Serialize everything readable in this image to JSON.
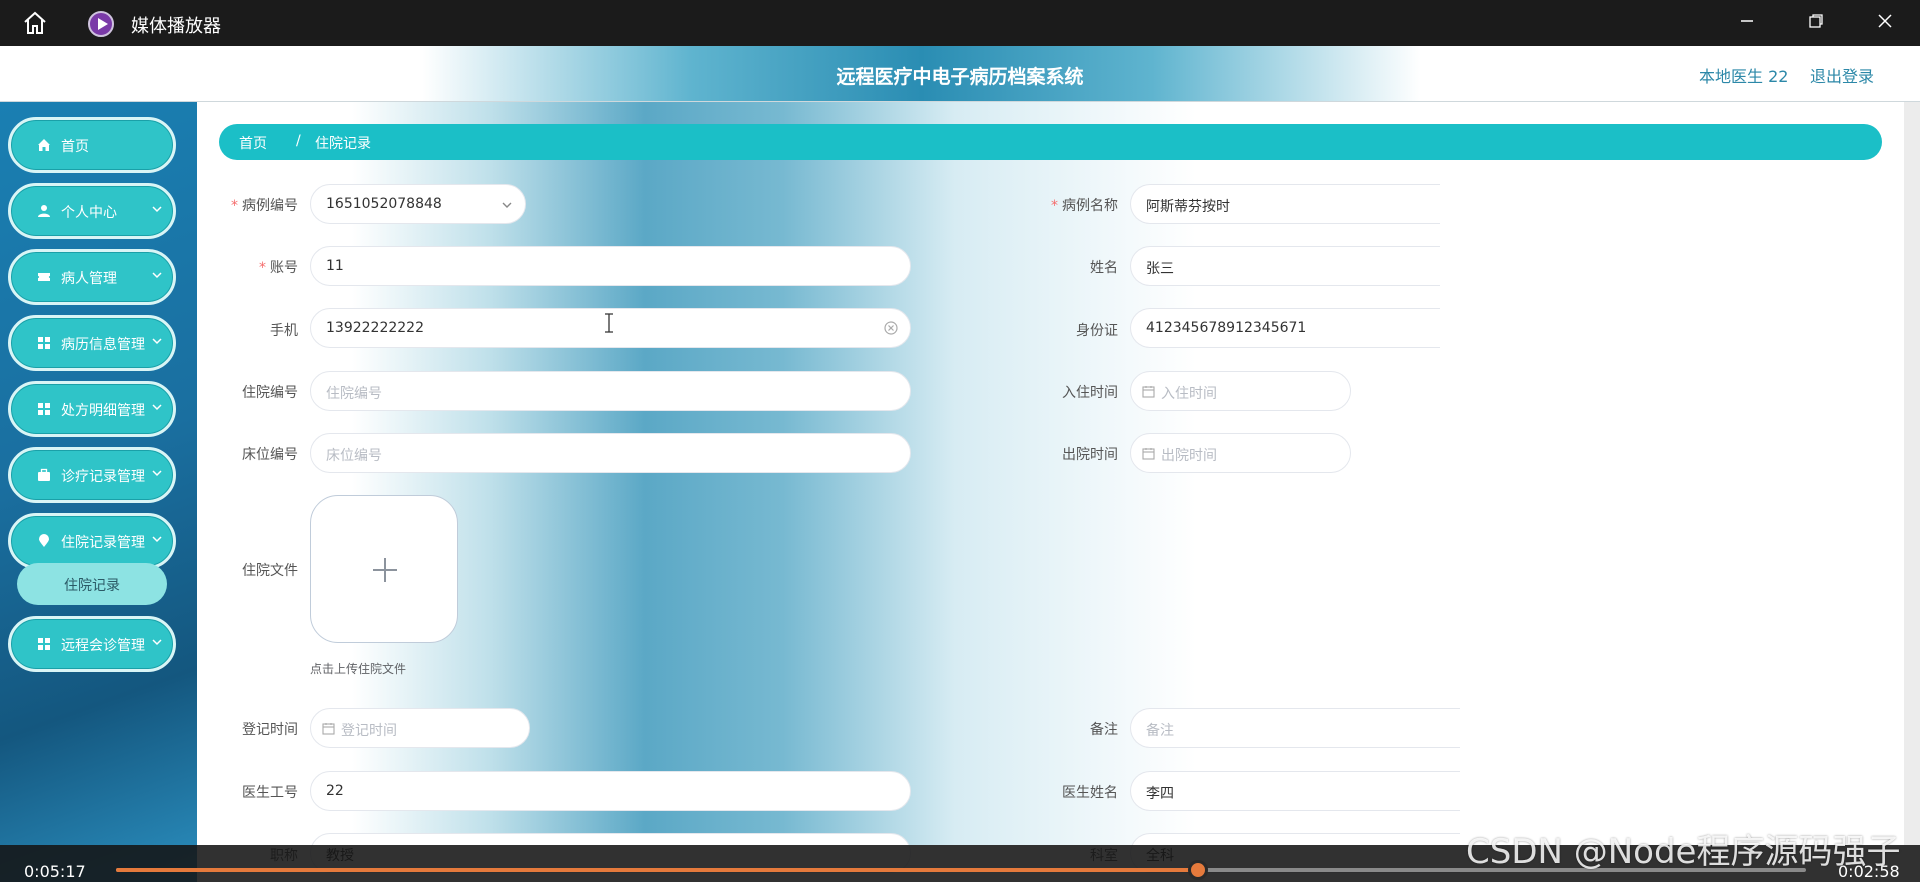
{
  "window": {
    "app_title": "媒体播放器"
  },
  "header": {
    "system_title": "远程医疗中电子病历档案系统",
    "user_label": "本地医生 22",
    "logout_label": "退出登录"
  },
  "sidebar": {
    "items": [
      {
        "label": "首页",
        "icon": "home-icon",
        "expandable": false
      },
      {
        "label": "个人中心",
        "icon": "user-icon",
        "expandable": true
      },
      {
        "label": "病人管理",
        "icon": "ticket-icon",
        "expandable": true
      },
      {
        "label": "病历信息管理",
        "icon": "grid-icon",
        "expandable": true
      },
      {
        "label": "处方明细管理",
        "icon": "grid-icon",
        "expandable": true
      },
      {
        "label": "诊疗记录管理",
        "icon": "briefcase-icon",
        "expandable": true
      },
      {
        "label": "住院记录管理",
        "icon": "pin-icon",
        "expandable": true
      },
      {
        "label": "远程会诊管理",
        "icon": "grid-icon",
        "expandable": true
      }
    ],
    "submenu": {
      "label": "住院记录"
    }
  },
  "breadcrumb": {
    "home": "首页",
    "separator": "/",
    "current": "住院记录"
  },
  "form": {
    "case_no": {
      "label": "病例编号",
      "value": "1651052078848"
    },
    "case_name": {
      "label": "病例名称",
      "value": "阿斯蒂芬按时"
    },
    "account": {
      "label": "账号",
      "value": "11"
    },
    "name": {
      "label": "姓名",
      "value": "张三"
    },
    "phone": {
      "label": "手机",
      "value": "13922222222"
    },
    "id_card": {
      "label": "身份证",
      "value": "412345678912345671"
    },
    "admission_no": {
      "label": "住院编号",
      "placeholder": "住院编号"
    },
    "admit_time": {
      "label": "入住时间",
      "placeholder": "入住时间"
    },
    "bed_no": {
      "label": "床位编号",
      "placeholder": "床位编号"
    },
    "discharge_time": {
      "label": "出院时间",
      "placeholder": "出院时间"
    },
    "admission_file": {
      "label": "住院文件",
      "tip": "点击上传住院文件"
    },
    "register_time": {
      "label": "登记时间",
      "placeholder": "登记时间"
    },
    "remark": {
      "label": "备注",
      "placeholder": "备注"
    },
    "doctor_no": {
      "label": "医生工号",
      "value": "22"
    },
    "doctor_name": {
      "label": "医生姓名",
      "value": "李四"
    },
    "title": {
      "label": "职称",
      "value": "教授"
    },
    "department": {
      "label": "科室",
      "value": "全科"
    }
  },
  "player": {
    "elapsed": "0:05:17",
    "remaining": "0:02:58",
    "progress": 0.64,
    "accent": "#e57a3c"
  },
  "watermark": "CSDN @Node程序源码强子"
}
